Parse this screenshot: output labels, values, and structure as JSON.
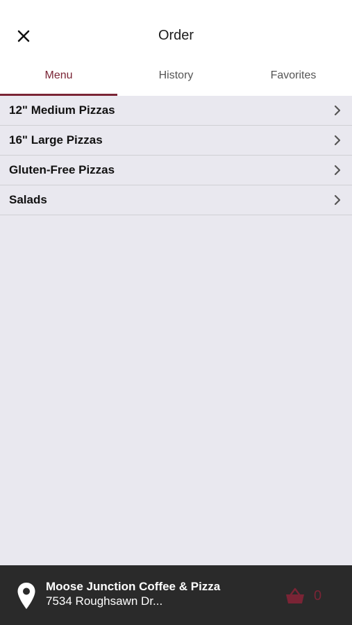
{
  "header": {
    "title": "Order",
    "close_icon": "close-icon"
  },
  "tabs": [
    {
      "label": "Menu",
      "active": true
    },
    {
      "label": "History",
      "active": false
    },
    {
      "label": "Favorites",
      "active": false
    }
  ],
  "menu": {
    "items": [
      {
        "label": "12\" Medium Pizzas"
      },
      {
        "label": "16\" Large Pizzas"
      },
      {
        "label": "Gluten-Free Pizzas"
      },
      {
        "label": "Salads"
      }
    ]
  },
  "footer": {
    "store_name": "Moose Junction Coffee & Pizza",
    "store_address": "7534 Roughsawn Dr...",
    "location_icon": "map-pin-icon",
    "cart_icon": "basket-icon",
    "cart_count": "0"
  },
  "colors": {
    "accent": "#7a2435",
    "background": "#e9e8ef",
    "footer": "#2a2a2a"
  }
}
